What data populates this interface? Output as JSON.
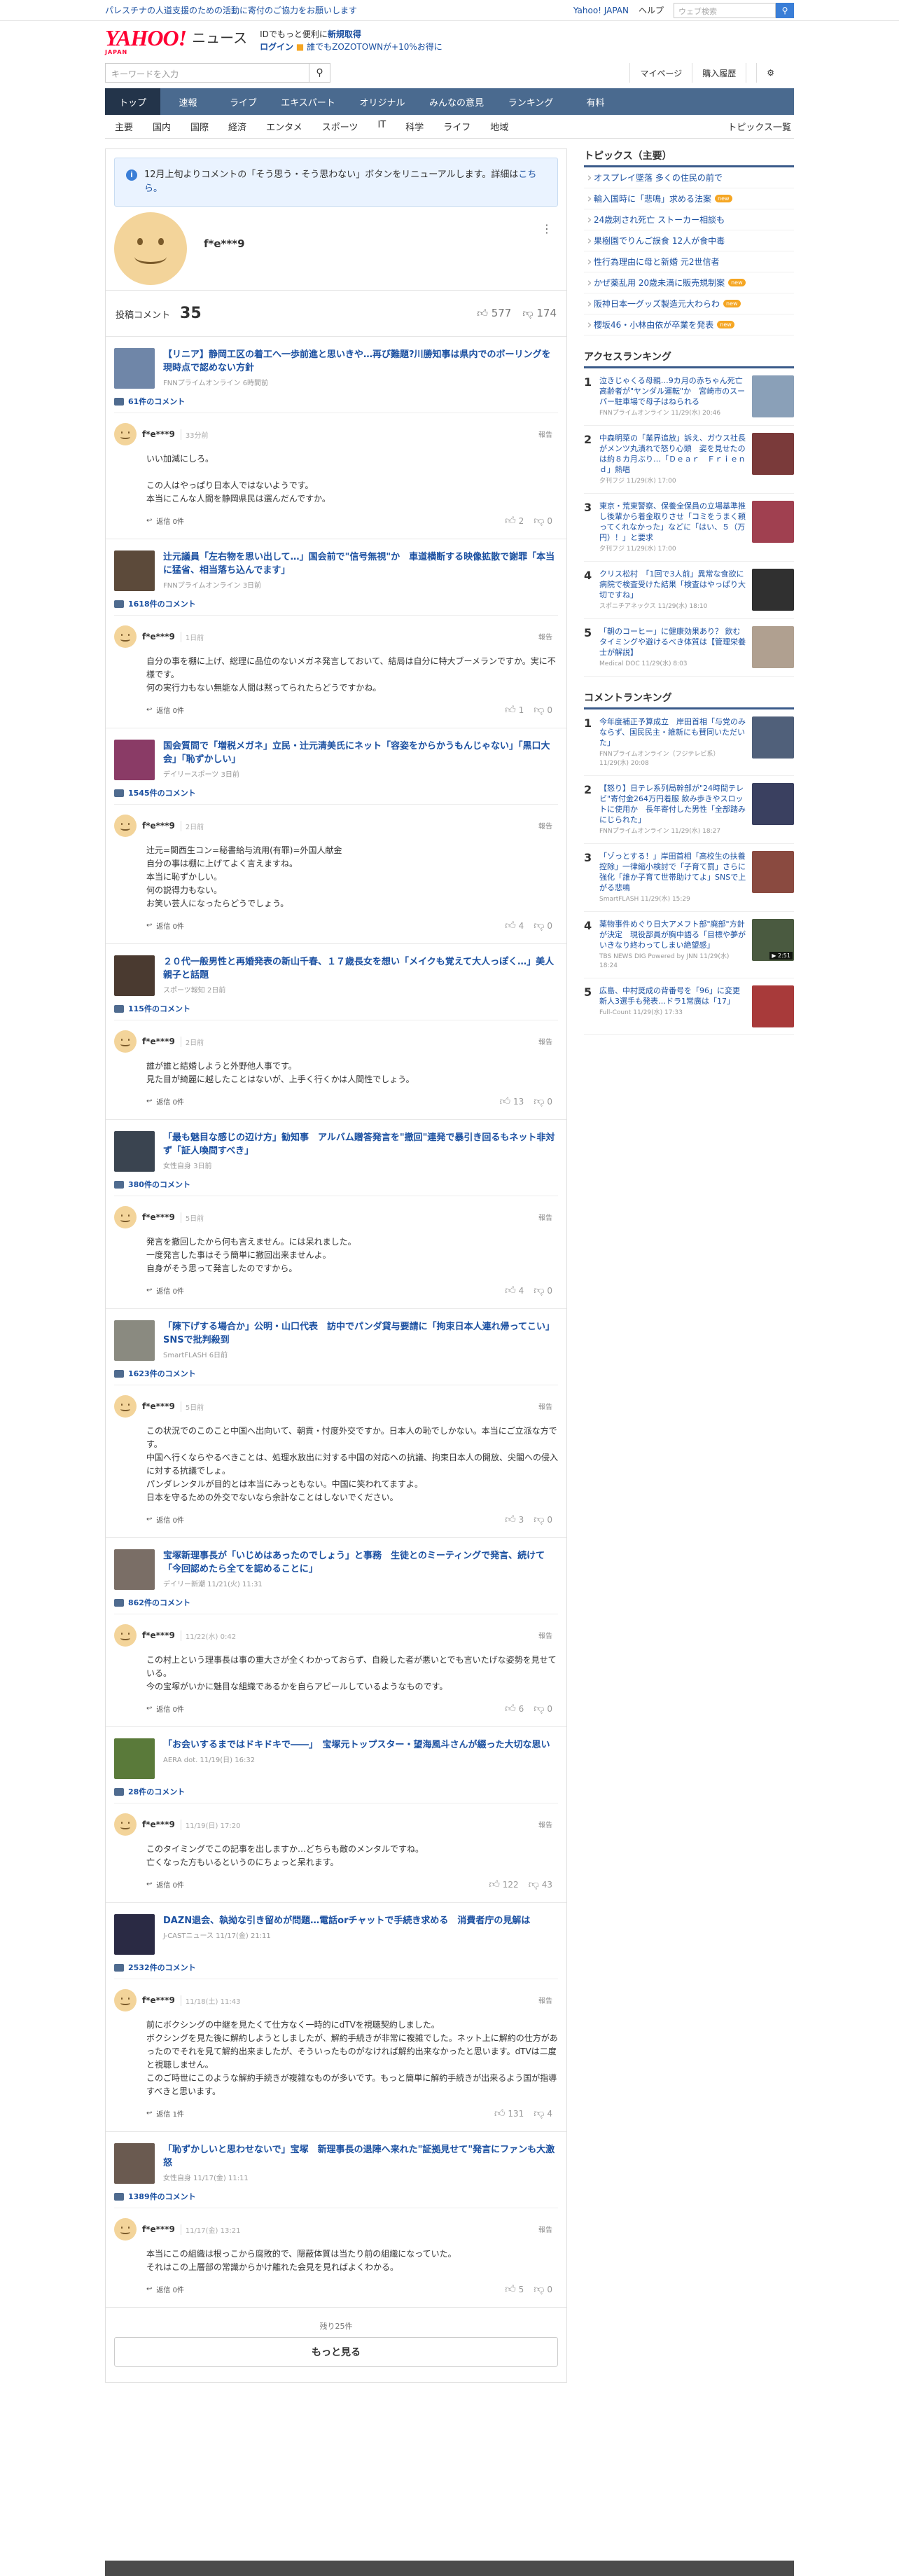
{
  "topbar": {
    "notice": "パレスチナの人道支援のための活動に寄付のご協力をお願いします",
    "links": [
      "Yahoo! JAPAN",
      "ヘルプ"
    ],
    "search_placeholder": "ウェブ検索"
  },
  "header": {
    "logo": "YAHOO!",
    "logo_sub": "JAPAN",
    "brand": "ニュース",
    "promo_line1_a": "IDでもっと便利に",
    "promo_line1_b": "新規取得",
    "promo_login": "ログイン",
    "promo_zozo": "誰でもZOZOTOWNが+10%お得に"
  },
  "searchrow": {
    "placeholder": "キーワードを入力",
    "mypage": "マイページ",
    "history": "購入履歴"
  },
  "nav": [
    "トップ",
    "速報",
    "ライブ",
    "エキスパート",
    "オリジナル",
    "みんなの意見",
    "ランキング",
    "有料"
  ],
  "subnav": {
    "items": [
      "主要",
      "国内",
      "国際",
      "経済",
      "エンタメ",
      "スポーツ",
      "IT",
      "科学",
      "ライフ",
      "地域"
    ],
    "more": "トピックス一覧"
  },
  "info": {
    "text": "12月上旬よりコメントの「そう思う・そう思わない」ボタンをリニューアルします。詳細は",
    "link": "こちら。"
  },
  "profile": {
    "name": "f*e***9",
    "stat_label": "投稿コメント",
    "stat_count": "35",
    "likes": "577",
    "dislikes": "174"
  },
  "blocks": [
    {
      "title": "【リニア】静岡工区の着工へ一歩前進と思いきや…再び難題?川勝知事は県内でのボーリングを現時点で認めない方針",
      "source": "FNNプライムオンライン 6時間前",
      "count": "61件のコメント",
      "user": "f*e***9",
      "time": "33分前",
      "report": "報告",
      "body": "いい加減にしろ。\n\nこの人はやっぱり日本人ではないようです。\n本当にこんな人間を静岡県民は選んだんですか。",
      "reply": "返信 0件",
      "up": "2",
      "down": "0",
      "thumb": "#6f86a8"
    },
    {
      "title": "辻元議員「左右物を思い出して…」国会前で\"信号無視\"か　車道横断する映像拡散で謝罪「本当に猛省、相当落ち込んでます」",
      "source": "FNNプライムオンライン 3日前",
      "count": "1618件のコメント",
      "user": "f*e***9",
      "time": "1日前",
      "report": "報告",
      "body": "自分の事を棚に上げ、総理に品位のないメガネ発言しておいて、結局は自分に特大ブーメランですか。実に不様です。\n何の実行力もない無能な人間は黙ってられたらどうですかね。",
      "reply": "返信 0件",
      "up": "1",
      "down": "0",
      "thumb": "#5c4a3a"
    },
    {
      "title": "国会質問で「増税メガネ」立民・辻元清美氏にネット「容姿をからかうもんじゃない」「黒口大会」「恥ずかしい」",
      "source": "デイリースポーツ 3日前",
      "count": "1545件のコメント",
      "user": "f*e***9",
      "time": "2日前",
      "report": "報告",
      "body": "辻元=関西生コン=秘書給与流用(有罪)=外国人献金\n自分の事は棚に上げてよく言えますね。\n本当に恥ずかしい。\n何の説得力もない。\nお笑い芸人になったらどうでしょう。",
      "reply": "返信 0件",
      "up": "4",
      "down": "0",
      "thumb": "#8a3b66"
    },
    {
      "title": "２０代一般男性と再婚発表の新山千春、１７歳長女を想い「メイクも覚えて大人っぽく…」美人親子と話題",
      "source": "スポーツ報知 2日前",
      "count": "115件のコメント",
      "user": "f*e***9",
      "time": "2日前",
      "report": "報告",
      "body": "誰が誰と結婚しようと外野他人事です。\n見た目が綺麗に越したことはないが、上手く行くかは人間性でしょう。",
      "reply": "返信 0件",
      "up": "13",
      "down": "0",
      "thumb": "#4a3a30"
    },
    {
      "title": "「最も魅目な感じの辺け方」勧知事　アルバム贈答発言を\"撤回\"連発で暴引き回るもネット非対ず「証人喚問すべき」",
      "source": "女性自身 3日前",
      "count": "380件のコメント",
      "user": "f*e***9",
      "time": "5日前",
      "report": "報告",
      "body": "発言を撤回したから何も言えません。には呆れました。\n一度発言した事はそう簡単に撤回出来ませんよ。\n自身がそう思って発言したのですから。",
      "reply": "返信 0件",
      "up": "4",
      "down": "0",
      "thumb": "#3a4450"
    },
    {
      "title": "「陳下げする場合か」公明・山口代表　訪中でパンダ貸与要請に「拘束日本人連れ帰ってこい」SNSで批判殺到",
      "source": "SmartFLASH 6日前",
      "count": "1623件のコメント",
      "user": "f*e***9",
      "time": "5日前",
      "report": "報告",
      "body": "この状況でのこのこと中国へ出向いて、朝貢・忖度外交ですか。日本人の恥でしかない。本当にご立派な方です。\n中国へ行くならやるべきことは、処理水放出に対する中国の対応への抗議、拘束日本人の開放、尖閣への侵入に対する抗議でしょ。\nパンダレンタルが目的とは本当にみっともない。中国に笑われてますよ。\n日本を守るための外交でないなら余計なことはしないでください。",
      "reply": "返信 0件",
      "up": "3",
      "down": "0",
      "thumb": "#8a8a80"
    },
    {
      "title": "宝塚新理事長が「いじめはあったのでしょう」と事務　生徒とのミーティングで発言、続けて「今回認めたら全てを認めることに」",
      "source": "デイリー新潮 11/21(火) 11:31",
      "count": "862件のコメント",
      "user": "f*e***9",
      "time": "11/22(水) 0:42",
      "report": "報告",
      "body": "この村上という理事長は事の重大さが全くわかっておらず、自殺した者が悪いとでも言いたげな姿勢を見せている。\n今の宝塚がいかに魅目な組織であるかを自らアピールしているようなものです。",
      "reply": "返信 0件",
      "up": "6",
      "down": "0",
      "thumb": "#7a6e66"
    },
    {
      "title": "「お会いするまではドキドキで――」　宝塚元トップスター・望海風斗さんが綴った大切な思い",
      "source": "AERA dot. 11/19(日) 16:32",
      "count": "28件のコメント",
      "user": "f*e***9",
      "time": "11/19(日) 17:20",
      "report": "報告",
      "body": "このタイミングでこの記事を出しますか…どちらも敵のメンタルですね。\n亡くなった方もいるというのにちょっと呆れます。",
      "reply": "返信 0件",
      "up": "122",
      "down": "43",
      "thumb": "#5a7a3a"
    },
    {
      "title": "DAZN退会、執拗な引き留めが問題…電話orチャットで手続き求める　消費者庁の見解は",
      "source": "J-CASTニュース 11/17(金) 21:11",
      "count": "2532件のコメント",
      "user": "f*e***9",
      "time": "11/18(土) 11:43",
      "report": "報告",
      "body": "前にボクシングの中継を見たくて仕方なく一時的にdTVを視聴契約しました。\nボクシングを見た後に解約しようとしましたが、解約手続きが非常に複雑でした。ネット上に解約の仕方があったのでそれを見て解約出来ましたが、そういったものがなければ解約出来なかったと思います。dTVは二度と視聴しません。\nこのご時世にこのような解約手続きが複雑なものが多いです。もっと簡単に解約手続きが出来るよう国が指導すべきと思います。",
      "reply": "返信 1件",
      "up": "131",
      "down": "4",
      "thumb": "#2a2a44"
    },
    {
      "title": "「恥ずかしいと思わせないで」宝塚　新理事長の退陣へ来れた\"証拠見せて\"発言にファンも大激怒",
      "source": "女性自身 11/17(金) 11:11",
      "count": "1389件のコメント",
      "user": "f*e***9",
      "time": "11/17(金) 13:21",
      "report": "報告",
      "body": "本当にこの組織は根っこから腐敗的で、隠蔽体質は当たり前の組織になっていた。\nそれはこの上層部の常識からかけ離れた会見を見ればよくわかる。",
      "reply": "返信 0件",
      "up": "5",
      "down": "0",
      "thumb": "#6a5a50"
    }
  ],
  "more": {
    "remain": "残り25件",
    "button": "もっと見る"
  },
  "sidebar": {
    "topics_title": "トピックス（主要）",
    "topics": [
      {
        "text": "オスプレイ墜落 多くの住民の前で",
        "badge": ""
      },
      {
        "text": "輸入国時に「悲鳴」求める法案",
        "badge": "new"
      },
      {
        "text": "24歳刺され死亡 ストーカー相談も",
        "badge": ""
      },
      {
        "text": "果樹園でりんご誤食 12人が食中毒",
        "badge": ""
      },
      {
        "text": "性行為理由に母と新婚 元2世信者",
        "badge": ""
      },
      {
        "text": "かぜ薬乱用 20歳未満に販売規制案",
        "badge": "new"
      },
      {
        "text": "阪神日本一グッズ製造元大わらわ",
        "badge": "new"
      },
      {
        "text": "櫻坂46・小林由依が卒業を発表",
        "badge": "new"
      }
    ],
    "access_title": "アクセスランキング",
    "access": [
      {
        "num": "1",
        "title": "泣きじゃくる母親…9カ月の赤ちゃん死亡　高齢者が\"ヤンダル運転\"か　宮崎市のスーパー駐車場で母子はねられる",
        "meta": "FNNプライムオンライン 11/29(水) 20:46",
        "color": "#8aa0b8",
        "video": ""
      },
      {
        "num": "2",
        "title": "中森明菜の「業界追放」訴え、ガウス社長がメンツ丸潰れで怒り心頭　姿を見せたのは約８カ月ぶり…「Ｄｅａｒ　Ｆｒｉｅｎｄ」熱唱",
        "meta": "夕刊フジ 11/29(水) 17:00",
        "color": "#7a3a3a",
        "video": ""
      },
      {
        "num": "3",
        "title": "東京・荒東警察、保養全保員の立場基準推し後輩から着金取りさせ「コミをうまく頼ってくれなかった」などに「はい、５（万円）！」と要求",
        "meta": "夕刊フジ 11/29(水) 17:00",
        "color": "#a04050",
        "video": ""
      },
      {
        "num": "4",
        "title": "クリス松村　「1回で3人前」異常な食欲に病院で検査受けた結果「検査はやっぱり大切ですね」",
        "meta": "スポニチアネックス 11/29(水) 18:10",
        "color": "#303030",
        "video": ""
      },
      {
        "num": "5",
        "title": "「朝のコーヒー」に健康効果あり？ 飲むタイミングや避けるべき体質は【管理栄養士が解説】",
        "meta": "Medical DOC 11/29(水) 8:03",
        "color": "#b0a090",
        "video": ""
      }
    ],
    "comment_title": "コメントランキング",
    "comments": [
      {
        "num": "1",
        "title": "今年度補正予算成立　岸田首相「与党のみならず、国民民主・維新にも賛同いただいた」",
        "meta": "FNNプライムオンライン（フジテレビ系） 11/29(水) 20:08",
        "color": "#50607a",
        "video": ""
      },
      {
        "num": "2",
        "title": "【怒り】日テレ系列局幹部が\"24時間テレビ\"寄付金264万円着服 飲み歩きやスロットに使用か　長年寄付した男性「全部踏みにじられた」",
        "meta": "FNNプライムオンライン 11/29(水) 18:27",
        "color": "#3a4060",
        "video": ""
      },
      {
        "num": "3",
        "title": "「ゾっとする！」岸田首相「高校生の扶養控除」一律縮小検討で「子育て罰」さらに強化「誰か子育て世帯助けてよ」SNSで上がる悲鳴",
        "meta": "SmartFLASH 11/29(水) 15:29",
        "color": "#8a4a40",
        "video": ""
      },
      {
        "num": "4",
        "title": "薬物事件めぐり日大アメフト部\"廃部\"方針が決定　現役部員が胸中語る「目標や夢がいきなり終わってしまい絶望感」",
        "meta": "TBS NEWS DIG Powered by JNN 11/29(水) 18:24",
        "color": "#4a5a40",
        "video": "▶ 2:51"
      },
      {
        "num": "5",
        "title": "広島、中村奨成の背番号を「96」に変更　新人3選手も発表…ドラ1常廣は「17」",
        "meta": "Full-Count 11/29(水) 17:33",
        "color": "#a83a3a",
        "video": ""
      }
    ]
  },
  "colors": {
    "accent": "#1b50a1",
    "nav": "#4a6a8f",
    "nav_active": "#23344a",
    "logo": "#ff0033"
  }
}
